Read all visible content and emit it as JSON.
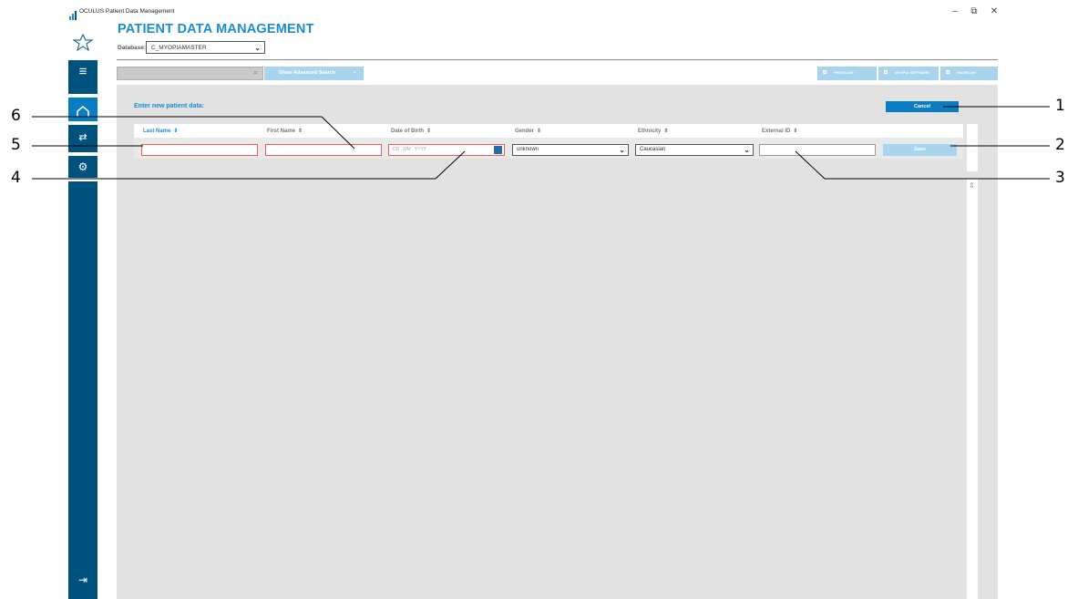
{
  "window": {
    "title": "OCULUS Patient Data Management",
    "minimize": "–",
    "restore": "⧉",
    "close": "✕"
  },
  "header": {
    "app_title": "PATIENT DATA MANAGEMENT",
    "database_label": "Database:",
    "database_value": "C_MYOPIAMASTER"
  },
  "toolbar": {
    "search_placeholder": "",
    "advanced_search_label": "Show Advanced Search",
    "ext_buttons": [
      "PENTACAM",
      "MYOPIA SOFTWARE",
      "MAXISCAN"
    ]
  },
  "form": {
    "enter_label": "Enter new patient data:",
    "cancel_label": "Cancel",
    "save_label": "Save",
    "columns": [
      "Last Name",
      "First Name",
      "Date of Birth",
      "Gender",
      "Ethnicity",
      "External ID"
    ],
    "date_placeholder": "DD . MM . YYYY",
    "gender_value": "unknown",
    "ethnicity_value": "Caucasian"
  },
  "callouts": [
    "1",
    "2",
    "3",
    "4",
    "5",
    "6"
  ],
  "colors": {
    "accent": "#1e8bd0",
    "sidebar": "#00527e",
    "sidebar_active": "#0a7cc1",
    "invalid_border": "#e06060",
    "disabled_button": "#a8d4ee"
  }
}
